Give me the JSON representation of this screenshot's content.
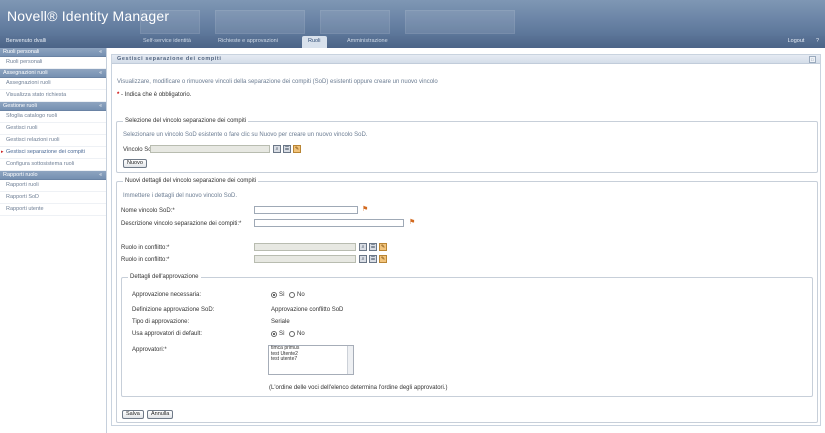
{
  "app": {
    "title": "Novell® Identity Manager"
  },
  "nav": {
    "left": "Benvenuto dvalli",
    "tabs": [
      "Self-service identità",
      "Richieste e approvazioni",
      "Ruoli",
      "Amministrazione"
    ],
    "active_tab": "Ruoli",
    "right": [
      "Logout",
      "?"
    ]
  },
  "sidebar": {
    "sections": [
      {
        "title": "Ruoli personali",
        "items": [
          "Ruoli personali"
        ]
      },
      {
        "title": "Assegnazioni ruoli",
        "items": [
          "Assegnazioni ruoli",
          "Visualizza stato richiesta"
        ]
      },
      {
        "title": "Gestione ruoli",
        "items": [
          "Sfoglia catalogo ruoli",
          "Gestisci ruoli",
          "Gestisci relazioni ruoli",
          "Gestisci separazione dei compiti",
          "Configura sottosistema ruoli"
        ]
      },
      {
        "title": "Rapporti ruolo",
        "items": [
          "Rapporti ruoli",
          "Rapporti SoD",
          "Rapporti utente"
        ]
      }
    ],
    "collapse_glyph": "«",
    "active_item": "Gestisci separazione dei compiti"
  },
  "main": {
    "title": "Gestisci separazione dei compiti",
    "intro": "Visualizzare, modificare o rimuovere vincoli della separazione dei compiti (SoD) esistenti oppure creare un nuovo vincolo",
    "required_note_star": "*",
    "required_note": "- Indica che è obbligatorio.",
    "select_box": {
      "legend": "Selezione del vincolo separazione dei compiti",
      "hint": "Selezionare un vincolo SoD esistente o fare clic su Nuovo per creare un nuovo vincolo SoD.",
      "field_label": "Vincolo SoD:",
      "new_button": "Nuovo"
    },
    "details_box": {
      "legend": "Nuovi dettagli del vincolo separazione dei compiti",
      "hint": "Immettere i dettagli del nuovo vincolo SoD.",
      "name_label": "Nome vincolo SoD:*",
      "description_label": "Descrizione vincolo separazione dei compiti:*",
      "conflict_role_1_label": "Ruolo in conflitto:*",
      "conflict_role_2_label": "Ruolo in conflitto:*"
    },
    "approval_box": {
      "legend": "Dettagli dell'approvazione",
      "approval_required_label": "Approvazione necessaria:",
      "approval_definition_label": "Definizione approvazione SoD:",
      "approval_definition_value": "Approvazione conflitto SoD",
      "approval_type_label": "Tipo di approvazione:",
      "approval_type_value": "Seriale",
      "use_default_label": "Usa approvatori di default:",
      "approvers_label": "Approvatori:*",
      "approvers": [
        "timca primus",
        "test Utente2",
        "test utente7"
      ],
      "order_note": "(L'ordine delle voci dell'elenco determina l'ordine degli approvatori.)",
      "yes": "Sì",
      "no": "No"
    },
    "save_button": "Salva",
    "cancel_button": "Annulla"
  }
}
